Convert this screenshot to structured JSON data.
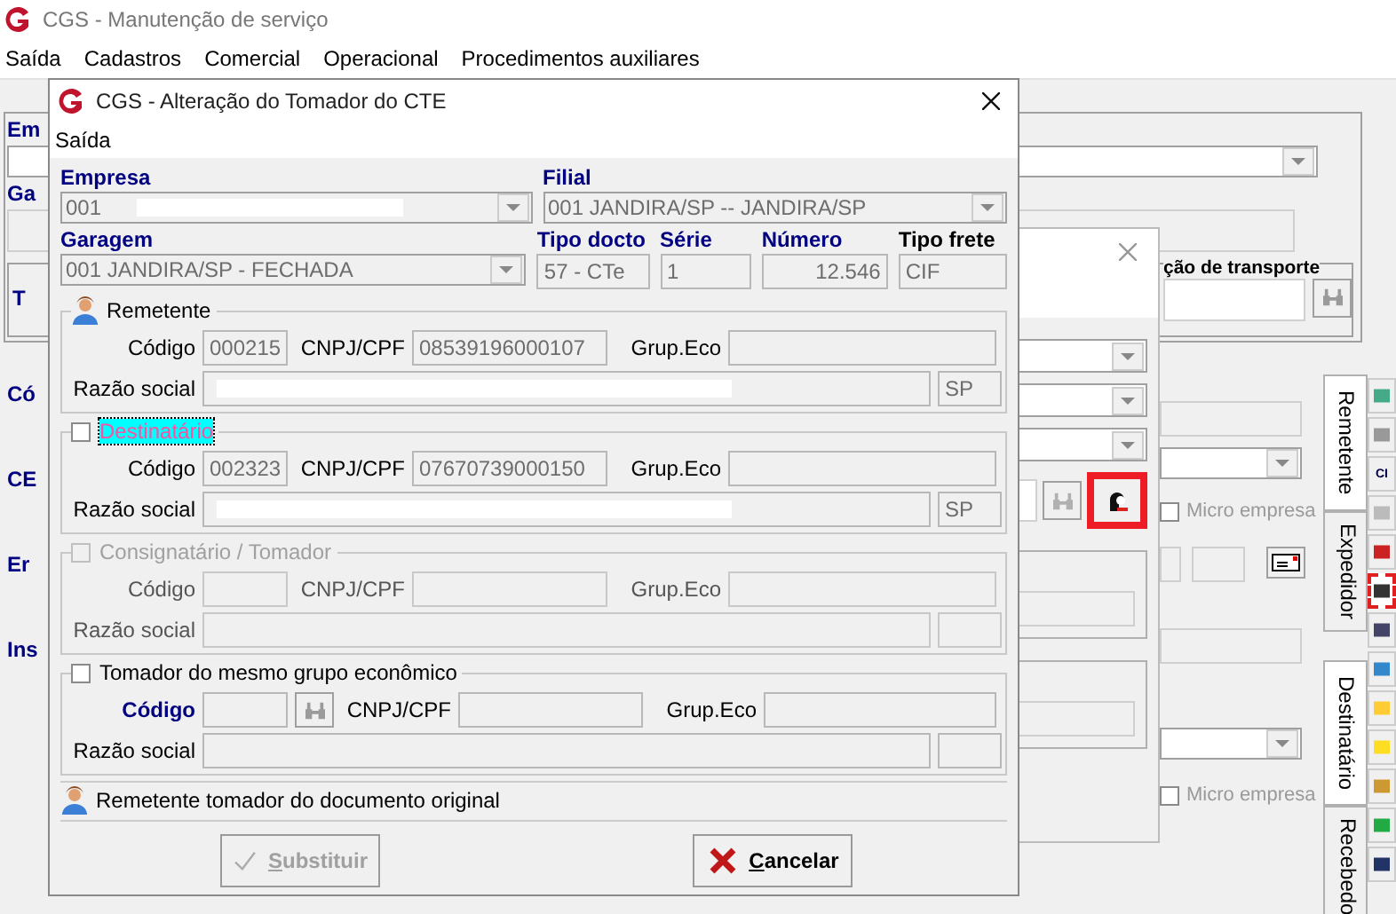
{
  "background_window": {
    "title": "CGS - Manutenção de serviço",
    "menu": [
      "Saída",
      "Cadastros",
      "Comercial",
      "Operacional",
      "Procedimentos auxiliares"
    ],
    "top_labels": [
      "Em",
      "Ga"
    ],
    "transport_group": {
      "inner_label": "T",
      "label": "ção de transporte"
    },
    "panel_labels": [
      "Có",
      "CE",
      "Er",
      "Ins"
    ],
    "upper_tabs": [
      {
        "label": "Remetente",
        "selected": true
      },
      {
        "label": "Expedidor",
        "selected": false
      }
    ],
    "lower_tabs": [
      {
        "label": "Destinatário",
        "selected": true
      },
      {
        "label": "Recebedo",
        "selected": false
      }
    ],
    "micro_empresa": [
      {
        "label": "Micro empresa",
        "checked": false
      },
      {
        "label": "Micro empresa",
        "checked": false
      }
    ],
    "toolbar": [
      {
        "selected": false
      },
      {
        "selected": false
      },
      {
        "label": "CI",
        "selected": false
      },
      {
        "selected": false
      },
      {
        "selected": false
      },
      {
        "selected": true
      },
      {
        "selected": false
      },
      {
        "selected": false
      },
      {
        "selected": false
      },
      {
        "selected": false
      },
      {
        "selected": false
      },
      {
        "selected": false
      },
      {
        "selected": false
      }
    ]
  },
  "middle_dialog": {
    "person_button_highlighted": true
  },
  "dialog": {
    "title": "CGS - Alteração do Tomador do CTE",
    "menu": [
      "Saída"
    ],
    "empresa": {
      "label": "Empresa",
      "value": "001",
      "redacted": true
    },
    "filial": {
      "label": "Filial",
      "value": "001 JANDIRA/SP -- JANDIRA/SP"
    },
    "garagem": {
      "label": "Garagem",
      "value": "001 JANDIRA/SP - FECHADA"
    },
    "tipo_docto": {
      "label": "Tipo docto",
      "value": "57 - CTe"
    },
    "serie": {
      "label": "Série",
      "value": "1"
    },
    "numero": {
      "label": "Número",
      "value": "12.546"
    },
    "tipo_frete": {
      "label": "Tipo frete",
      "value": "CIF"
    },
    "groups": [
      {
        "kind": "person",
        "title": "Remetente",
        "disabled": false,
        "code_label": "Código",
        "code": "000215",
        "doc_label": "CNPJ/CPF",
        "doc": "08539196000107",
        "grp_label": "Grup.Eco",
        "name_label": "Razão social",
        "name_redacted": true,
        "uf": "SP"
      },
      {
        "kind": "checkbox",
        "title": "Destinatário",
        "checked": false,
        "focused": true,
        "disabled": false,
        "code_label": "Código",
        "code": "002323",
        "doc_label": "CNPJ/CPF",
        "doc": "07670739000150",
        "grp_label": "Grup.Eco",
        "name_label": "Razão social",
        "name_redacted": true,
        "uf": "SP"
      },
      {
        "kind": "checkbox",
        "title": "Consignatário / Tomador",
        "checked": false,
        "focused": false,
        "disabled": true,
        "code_label": "Código",
        "doc_label": "CNPJ/CPF",
        "grp_label": "Grup.Eco",
        "name_label": "Razão social"
      },
      {
        "kind": "checkbox",
        "title": "Tomador do mesmo grupo econômico",
        "checked": false,
        "focused": false,
        "disabled": false,
        "lookup": true,
        "code_label": "Código",
        "doc_label": "CNPJ/CPF",
        "grp_label": "Grup.Eco",
        "name_label": "Razão social"
      }
    ],
    "status": "Remetente tomador do documento original",
    "buttons": [
      {
        "kind": "confirm",
        "label": "Substituir",
        "disabled": true
      },
      {
        "kind": "cancel",
        "label": "Cancelar",
        "disabled": false
      }
    ]
  }
}
